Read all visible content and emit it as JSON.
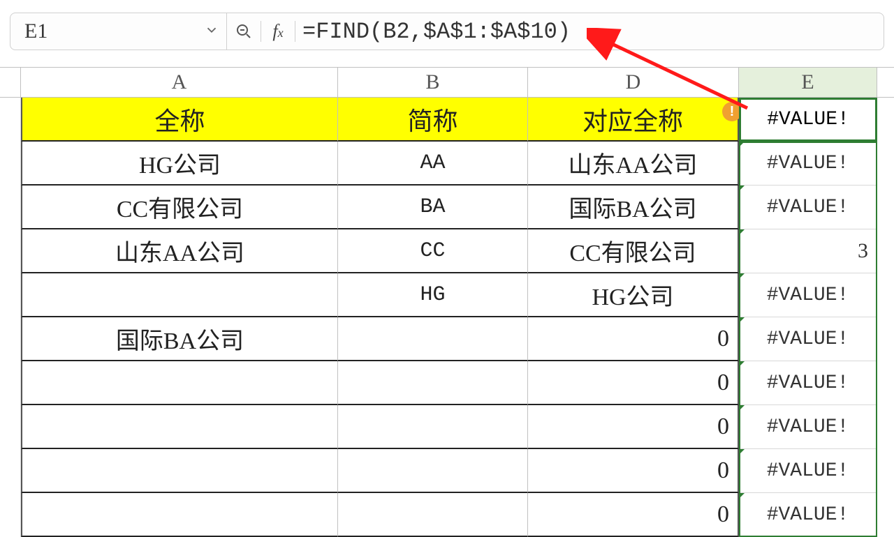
{
  "formula_bar": {
    "cell_ref": "E1",
    "formula": "=FIND(B2,$A$1:$A$10)"
  },
  "columns": [
    "A",
    "B",
    "D",
    "E"
  ],
  "headers": {
    "a": "全称",
    "b": "简称",
    "d": "对应全称"
  },
  "rows": [
    {
      "a": "HG公司",
      "b": "AA",
      "d": "山东AA公司",
      "e": "#VALUE!"
    },
    {
      "a": "CC有限公司",
      "b": "BA",
      "d": "国际BA公司",
      "e": "#VALUE!"
    },
    {
      "a": "山东AA公司",
      "b": "CC",
      "d": "CC有限公司",
      "e": "3"
    },
    {
      "a": "",
      "b": "HG",
      "d": "HG公司",
      "e": "#VALUE!"
    },
    {
      "a": "国际BA公司",
      "b": "",
      "d": "0",
      "e": "#VALUE!"
    },
    {
      "a": "",
      "b": "",
      "d": "0",
      "e": "#VALUE!"
    },
    {
      "a": "",
      "b": "",
      "d": "0",
      "e": "#VALUE!"
    },
    {
      "a": "",
      "b": "",
      "d": "0",
      "e": "#VALUE!"
    },
    {
      "a": "",
      "b": "",
      "d": "0",
      "e": "#VALUE!"
    }
  ],
  "active_cell_value": "#VALUE!",
  "error_glyph": "!",
  "expander_glyph": "◂ ▸"
}
